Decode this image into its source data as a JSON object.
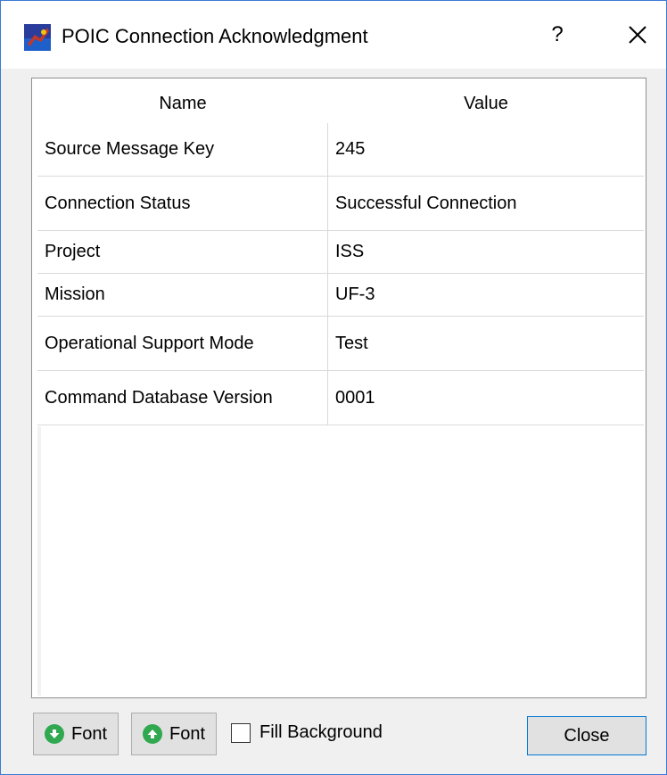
{
  "window": {
    "title": "POIC Connection Acknowledgment",
    "help_label": "?",
    "close_icon": "close-icon"
  },
  "table": {
    "columns": [
      "Name",
      "Value"
    ],
    "rows": [
      {
        "name": "Source Message Key",
        "value": "245"
      },
      {
        "name": "Connection Status",
        "value": "Successful Connection"
      },
      {
        "name": "Project",
        "value": "ISS"
      },
      {
        "name": "Mission",
        "value": "UF-3"
      },
      {
        "name": "Operational Support Mode",
        "value": "Test"
      },
      {
        "name": "Command Database Version",
        "value": "0001"
      }
    ]
  },
  "footer": {
    "font_decrease_label": "Font",
    "font_increase_label": "Font",
    "fill_background_label": "Fill Background",
    "fill_background_checked": false,
    "close_label": "Close"
  },
  "colors": {
    "accent_border": "#3a7bd5",
    "button_focus": "#0078d7",
    "font_icon_green": "#2fa84f"
  }
}
